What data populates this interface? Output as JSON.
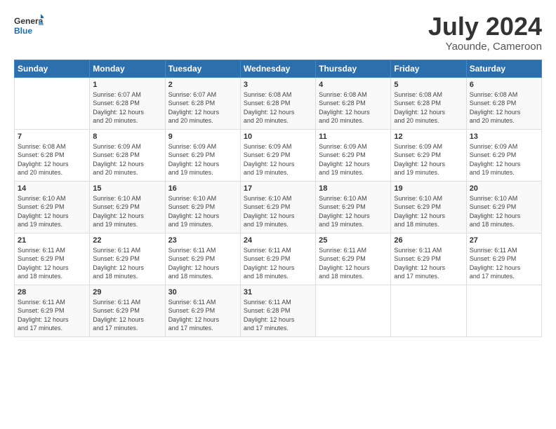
{
  "logo": {
    "line1": "General",
    "line2": "Blue"
  },
  "title": "July 2024",
  "subtitle": "Yaounde, Cameroon",
  "headers": [
    "Sunday",
    "Monday",
    "Tuesday",
    "Wednesday",
    "Thursday",
    "Friday",
    "Saturday"
  ],
  "weeks": [
    [
      {
        "day": "",
        "info": ""
      },
      {
        "day": "1",
        "info": "Sunrise: 6:07 AM\nSunset: 6:28 PM\nDaylight: 12 hours\nand 20 minutes."
      },
      {
        "day": "2",
        "info": "Sunrise: 6:07 AM\nSunset: 6:28 PM\nDaylight: 12 hours\nand 20 minutes."
      },
      {
        "day": "3",
        "info": "Sunrise: 6:08 AM\nSunset: 6:28 PM\nDaylight: 12 hours\nand 20 minutes."
      },
      {
        "day": "4",
        "info": "Sunrise: 6:08 AM\nSunset: 6:28 PM\nDaylight: 12 hours\nand 20 minutes."
      },
      {
        "day": "5",
        "info": "Sunrise: 6:08 AM\nSunset: 6:28 PM\nDaylight: 12 hours\nand 20 minutes."
      },
      {
        "day": "6",
        "info": "Sunrise: 6:08 AM\nSunset: 6:28 PM\nDaylight: 12 hours\nand 20 minutes."
      }
    ],
    [
      {
        "day": "7",
        "info": "Sunrise: 6:08 AM\nSunset: 6:28 PM\nDaylight: 12 hours\nand 20 minutes."
      },
      {
        "day": "8",
        "info": "Sunrise: 6:09 AM\nSunset: 6:28 PM\nDaylight: 12 hours\nand 20 minutes."
      },
      {
        "day": "9",
        "info": "Sunrise: 6:09 AM\nSunset: 6:29 PM\nDaylight: 12 hours\nand 19 minutes."
      },
      {
        "day": "10",
        "info": "Sunrise: 6:09 AM\nSunset: 6:29 PM\nDaylight: 12 hours\nand 19 minutes."
      },
      {
        "day": "11",
        "info": "Sunrise: 6:09 AM\nSunset: 6:29 PM\nDaylight: 12 hours\nand 19 minutes."
      },
      {
        "day": "12",
        "info": "Sunrise: 6:09 AM\nSunset: 6:29 PM\nDaylight: 12 hours\nand 19 minutes."
      },
      {
        "day": "13",
        "info": "Sunrise: 6:09 AM\nSunset: 6:29 PM\nDaylight: 12 hours\nand 19 minutes."
      }
    ],
    [
      {
        "day": "14",
        "info": "Sunrise: 6:10 AM\nSunset: 6:29 PM\nDaylight: 12 hours\nand 19 minutes."
      },
      {
        "day": "15",
        "info": "Sunrise: 6:10 AM\nSunset: 6:29 PM\nDaylight: 12 hours\nand 19 minutes."
      },
      {
        "day": "16",
        "info": "Sunrise: 6:10 AM\nSunset: 6:29 PM\nDaylight: 12 hours\nand 19 minutes."
      },
      {
        "day": "17",
        "info": "Sunrise: 6:10 AM\nSunset: 6:29 PM\nDaylight: 12 hours\nand 19 minutes."
      },
      {
        "day": "18",
        "info": "Sunrise: 6:10 AM\nSunset: 6:29 PM\nDaylight: 12 hours\nand 19 minutes."
      },
      {
        "day": "19",
        "info": "Sunrise: 6:10 AM\nSunset: 6:29 PM\nDaylight: 12 hours\nand 18 minutes."
      },
      {
        "day": "20",
        "info": "Sunrise: 6:10 AM\nSunset: 6:29 PM\nDaylight: 12 hours\nand 18 minutes."
      }
    ],
    [
      {
        "day": "21",
        "info": "Sunrise: 6:11 AM\nSunset: 6:29 PM\nDaylight: 12 hours\nand 18 minutes."
      },
      {
        "day": "22",
        "info": "Sunrise: 6:11 AM\nSunset: 6:29 PM\nDaylight: 12 hours\nand 18 minutes."
      },
      {
        "day": "23",
        "info": "Sunrise: 6:11 AM\nSunset: 6:29 PM\nDaylight: 12 hours\nand 18 minutes."
      },
      {
        "day": "24",
        "info": "Sunrise: 6:11 AM\nSunset: 6:29 PM\nDaylight: 12 hours\nand 18 minutes."
      },
      {
        "day": "25",
        "info": "Sunrise: 6:11 AM\nSunset: 6:29 PM\nDaylight: 12 hours\nand 18 minutes."
      },
      {
        "day": "26",
        "info": "Sunrise: 6:11 AM\nSunset: 6:29 PM\nDaylight: 12 hours\nand 17 minutes."
      },
      {
        "day": "27",
        "info": "Sunrise: 6:11 AM\nSunset: 6:29 PM\nDaylight: 12 hours\nand 17 minutes."
      }
    ],
    [
      {
        "day": "28",
        "info": "Sunrise: 6:11 AM\nSunset: 6:29 PM\nDaylight: 12 hours\nand 17 minutes."
      },
      {
        "day": "29",
        "info": "Sunrise: 6:11 AM\nSunset: 6:29 PM\nDaylight: 12 hours\nand 17 minutes."
      },
      {
        "day": "30",
        "info": "Sunrise: 6:11 AM\nSunset: 6:29 PM\nDaylight: 12 hours\nand 17 minutes."
      },
      {
        "day": "31",
        "info": "Sunrise: 6:11 AM\nSunset: 6:28 PM\nDaylight: 12 hours\nand 17 minutes."
      },
      {
        "day": "",
        "info": ""
      },
      {
        "day": "",
        "info": ""
      },
      {
        "day": "",
        "info": ""
      }
    ]
  ]
}
